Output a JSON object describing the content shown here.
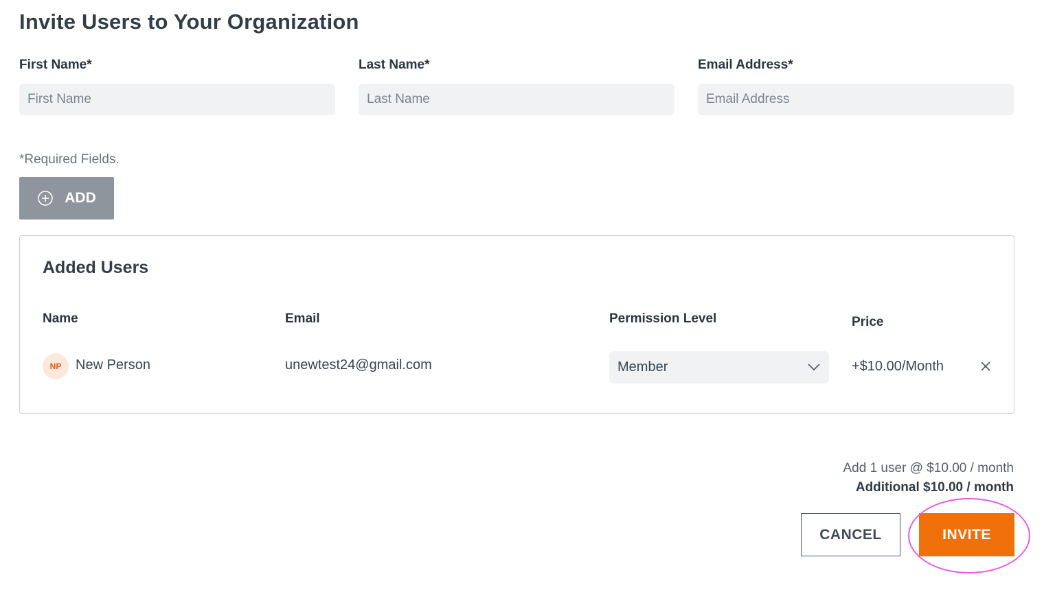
{
  "page": {
    "title": "Invite Users to Your Organization"
  },
  "form": {
    "first_name": {
      "label": "First Name*",
      "placeholder": "First Name",
      "value": ""
    },
    "last_name": {
      "label": "Last Name*",
      "placeholder": "Last Name",
      "value": ""
    },
    "email": {
      "label": "Email Address*",
      "placeholder": "Email Address",
      "value": ""
    },
    "required_note": "*Required Fields.",
    "add_button": {
      "label": "ADD",
      "icon": "plus-circle-icon"
    }
  },
  "added_users": {
    "title": "Added Users",
    "columns": {
      "name": "Name",
      "email": "Email",
      "permission": "Permission Level",
      "price": "Price"
    },
    "rows": [
      {
        "initials": "NP",
        "name": "New Person",
        "email": "unewtest24@gmail.com",
        "permission": "Member",
        "price": "+$10.00/Month",
        "remove_icon": "close-icon"
      }
    ]
  },
  "summary": {
    "line1": "Add 1 user @ $10.00 / month",
    "line2": "Additional $10.00 / month"
  },
  "actions": {
    "cancel_label": "CANCEL",
    "invite_label": "INVITE"
  },
  "colors": {
    "accent": "#f0700a",
    "add_button_bg": "#8f959d",
    "input_bg": "#f0f2f4",
    "avatar_bg": "#fde8dc",
    "avatar_text": "#e2591f",
    "highlight": "#ea5ae8"
  }
}
